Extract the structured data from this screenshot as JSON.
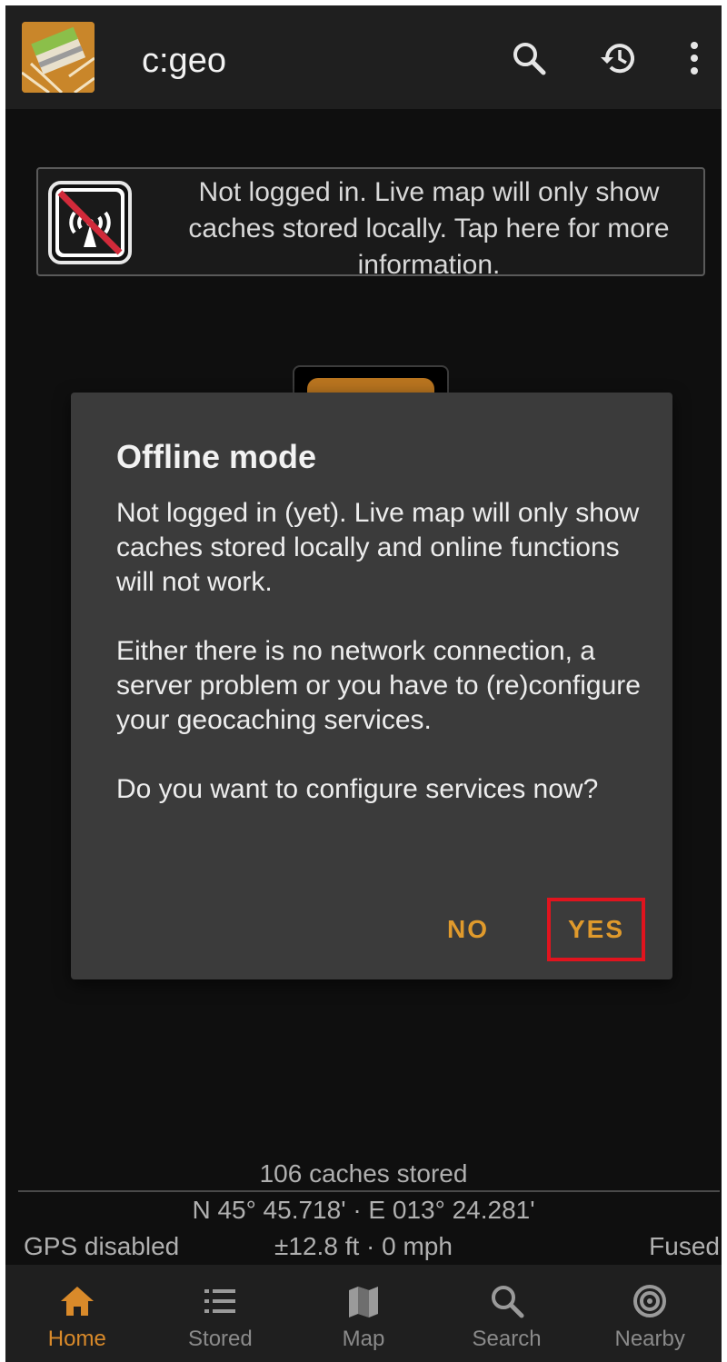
{
  "app": {
    "title": "c:geo"
  },
  "appbar": {
    "search_icon": "search-icon",
    "history_icon": "history-icon",
    "menu_icon": "more-vert-icon"
  },
  "banner": {
    "text": "Not logged in. Live map will only show caches stored locally. Tap here for more information.",
    "icon": "no-signal-icon"
  },
  "dialog": {
    "title": "Offline mode",
    "paragraphs": [
      "Not logged in (yet). Live map will only show caches stored locally and online functions will not work.",
      "Either there is no network connection, a server problem or you have to (re)configure your geocaching services.",
      "Do you want to configure services now?"
    ],
    "no_label": "NO",
    "yes_label": "YES"
  },
  "status": {
    "caches_stored": "106 caches stored",
    "coordinates": "N 45° 45.718' · E 013° 24.281'",
    "gps": "GPS disabled",
    "accuracy_speed": "±12.8 ft · 0 mph",
    "provider": "Fused"
  },
  "nav": {
    "items": [
      {
        "label": "Home",
        "icon": "home-icon",
        "active": true
      },
      {
        "label": "Stored",
        "icon": "list-icon",
        "active": false
      },
      {
        "label": "Map",
        "icon": "map-icon",
        "active": false
      },
      {
        "label": "Search",
        "icon": "search-icon",
        "active": false
      },
      {
        "label": "Nearby",
        "icon": "nearby-icon",
        "active": false
      }
    ]
  },
  "colors": {
    "accent": "#e09a2c",
    "nav_active": "#d98a2a",
    "highlight_box": "#e0141e",
    "dialog_bg": "#3b3b3b",
    "appbar_bg": "#1f1f1f"
  }
}
